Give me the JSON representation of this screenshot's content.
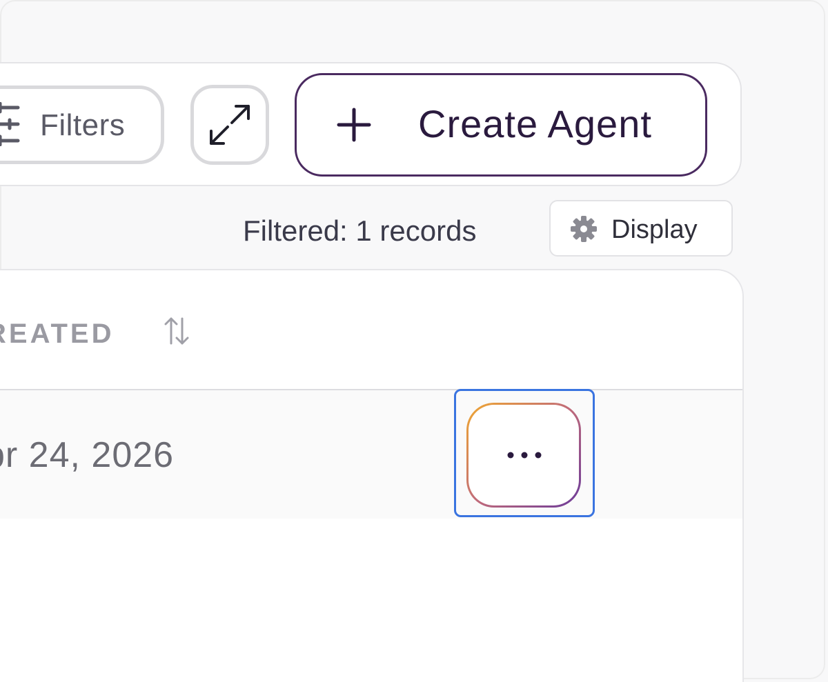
{
  "toolbar": {
    "filters_label": "Filters",
    "create_label": "Create Agent",
    "icons": {
      "filters": "filter-sliders-icon",
      "expand": "expand-arrows-icon",
      "create": "plus-icon"
    }
  },
  "summary": {
    "filtered_text": "Filtered: 1 records",
    "display_label": "Display",
    "display_icon": "gear-icon"
  },
  "table": {
    "columns": [
      {
        "label": "REATED",
        "sort_icon": "sort-arrows-icon"
      }
    ],
    "rows": [
      {
        "created": "pr 24, 2026",
        "actions_icon": "more-dots-icon"
      }
    ]
  },
  "colors": {
    "accent": "#4a2a60",
    "focus": "#3a74e0",
    "actions_gradient_start": "#f0a830",
    "actions_gradient_end": "#6a3a9a"
  }
}
